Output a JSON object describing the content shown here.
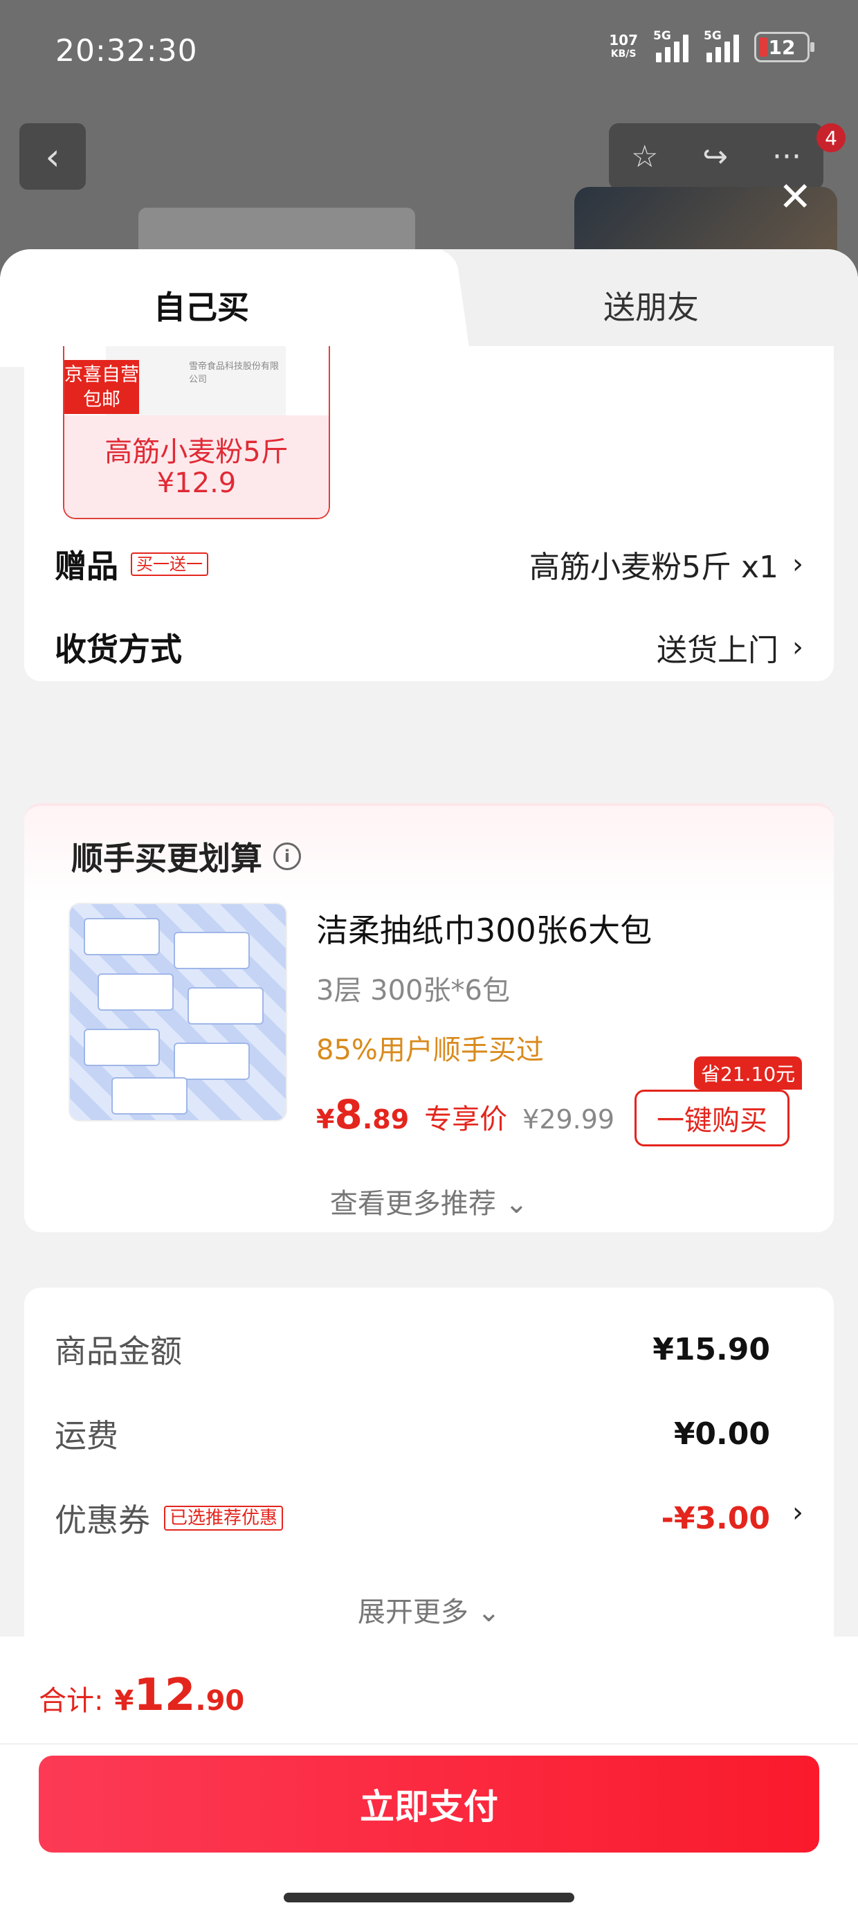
{
  "status": {
    "time": "20:32:30",
    "net_speed": "107",
    "net_unit": "KB/S",
    "signal1": "5G",
    "signal2": "5G",
    "battery": "12"
  },
  "nav": {
    "back": "‹",
    "star": "☆",
    "share": "↪",
    "more": "···",
    "badge": "4",
    "close": "✕"
  },
  "tabs": {
    "self": "自己买",
    "friend": "送朋友"
  },
  "gift_thumb": {
    "img_text": "雪帝食品科技股份有限公司",
    "tag_line1": "京喜自营",
    "tag_line2": "包邮",
    "name": "高筋小麦粉5斤",
    "price": "¥12.9"
  },
  "gift_row": {
    "label": "赠品",
    "tag": "买一送一",
    "value": "高筋小麦粉5斤 x1",
    "chevron": "›"
  },
  "delivery_row": {
    "label": "收货方式",
    "value": "送货上门",
    "chevron": "›"
  },
  "recommend": {
    "title": "顺手买更划算",
    "info": "i",
    "name": "洁柔抽纸巾300张6大包",
    "spec": "3层 300张*6包",
    "stat": "85%用户顺手买过",
    "currency": "¥",
    "price_int": "8",
    "price_dec": ".89",
    "exclusive": "专享价",
    "orig_price": "¥29.99",
    "save_tag": "省21.10元",
    "buy_button": "一键购买",
    "more": "查看更多推荐 ⌄"
  },
  "summary": {
    "goods_label": "商品金额",
    "goods_value": "¥15.90",
    "shipping_label": "运费",
    "shipping_value": "¥0.00",
    "coupon_label": "优惠券",
    "coupon_tag": "已选推荐优惠",
    "coupon_value": "-¥3.00",
    "coupon_chevron": "›",
    "expand": "展开更多 ⌄"
  },
  "footer": {
    "total_label": "合计:",
    "currency": "¥",
    "total_int": "12",
    "total_dec": ".90",
    "pay_button": "立即支付"
  },
  "colors": {
    "accent": "#e4251d",
    "pay_gradient_start": "#fc3a55",
    "pay_gradient_end": "#fa1a2c",
    "stat_orange": "#d98a1c"
  }
}
